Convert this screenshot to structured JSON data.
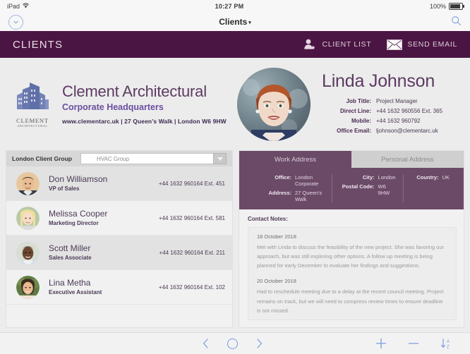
{
  "statusbar": {
    "device": "iPad",
    "wifi_icon": "wifi-icon",
    "time": "10:27 PM",
    "battery_text": "100%",
    "battery_icon": "battery-full-icon"
  },
  "navbar": {
    "back_icon": "chevron-down-circle-icon",
    "title": "Clients",
    "title_caret": "▾",
    "search_icon": "search-icon"
  },
  "appheader": {
    "title": "CLIENTS",
    "accent_color": "#4b1543",
    "actions": [
      {
        "label": "CLIENT LIST",
        "icon": "client-list-icon"
      },
      {
        "label": "SEND EMAIL",
        "icon": "envelope-icon"
      }
    ]
  },
  "company": {
    "logo_name": "CLEMENT",
    "logo_sub": "ARCHITECTURAL",
    "name": "Clement Architectural",
    "subtitle": "Corporate Headquarters",
    "address_line": "www.clementarc.uk | 27 Queen's Walk | London W6 9HW"
  },
  "person": {
    "avatar": "profile-photo",
    "name": "Linda Johnson",
    "details": [
      {
        "label": "Job Title:",
        "value": "Project Manager"
      },
      {
        "label": "Direct Line:",
        "value": "+44 1632 960556  Ext. 365"
      },
      {
        "label": "Mobile:",
        "value": "+44 1632 960792"
      },
      {
        "label": "Office Email:",
        "value": "ljohnson@clementarc.uk"
      }
    ]
  },
  "client_list": {
    "group_label": "London Client Group",
    "group_select_value": "HVAC Group",
    "rows": [
      {
        "name": "Don Williamson",
        "role": "VP of Sales",
        "phone": "+44 1632 960164  Ext. 451"
      },
      {
        "name": "Melissa Cooper",
        "role": "Marketing Director",
        "phone": "+44 1632 960164  Ext. 581"
      },
      {
        "name": "Scott Miller",
        "role": "Sales Associate",
        "phone": "+44 1632 960164  Ext. 211"
      },
      {
        "name": "Lina Metha",
        "role": "Executive Assistant",
        "phone": "+44 1632 960164  Ext. 102"
      }
    ]
  },
  "detail_panel": {
    "tabs": [
      {
        "label": "Work Address",
        "active": true
      },
      {
        "label": "Personal Address",
        "active": false
      }
    ],
    "address": {
      "office_label": "Office:",
      "office_value": "London Corporate",
      "address_label": "Address:",
      "address_value": "27 Queen's Walk",
      "city_label": "City:",
      "city_value": "London",
      "postal_label": "Postal Code:",
      "postal_value": "W6 9HW",
      "country_label": "Country:",
      "country_value": "UK"
    },
    "notes_title": "Contact Notes:",
    "notes": [
      {
        "date": "18 October 2018",
        "text": "Met with Linda to discuss the feasibility of the new project. She was favoring our approach, but was still exploring other options. A follow up meeting is being planned for early December to evaluate her findings and suggestions."
      },
      {
        "date": "20 October 2018",
        "text": "Had to reschedule meeting due to a delay at the recent council meeting. Project remains on track, but we will need to compress review times to ensure deadline is not missed."
      }
    ]
  },
  "toolbar": {
    "prev_icon": "chevron-left-icon",
    "record_icon": "circle-icon",
    "next_icon": "chevron-right-icon",
    "add_icon": "plus-icon",
    "remove_icon": "minus-icon",
    "sort_icon": "sort-az-icon"
  }
}
